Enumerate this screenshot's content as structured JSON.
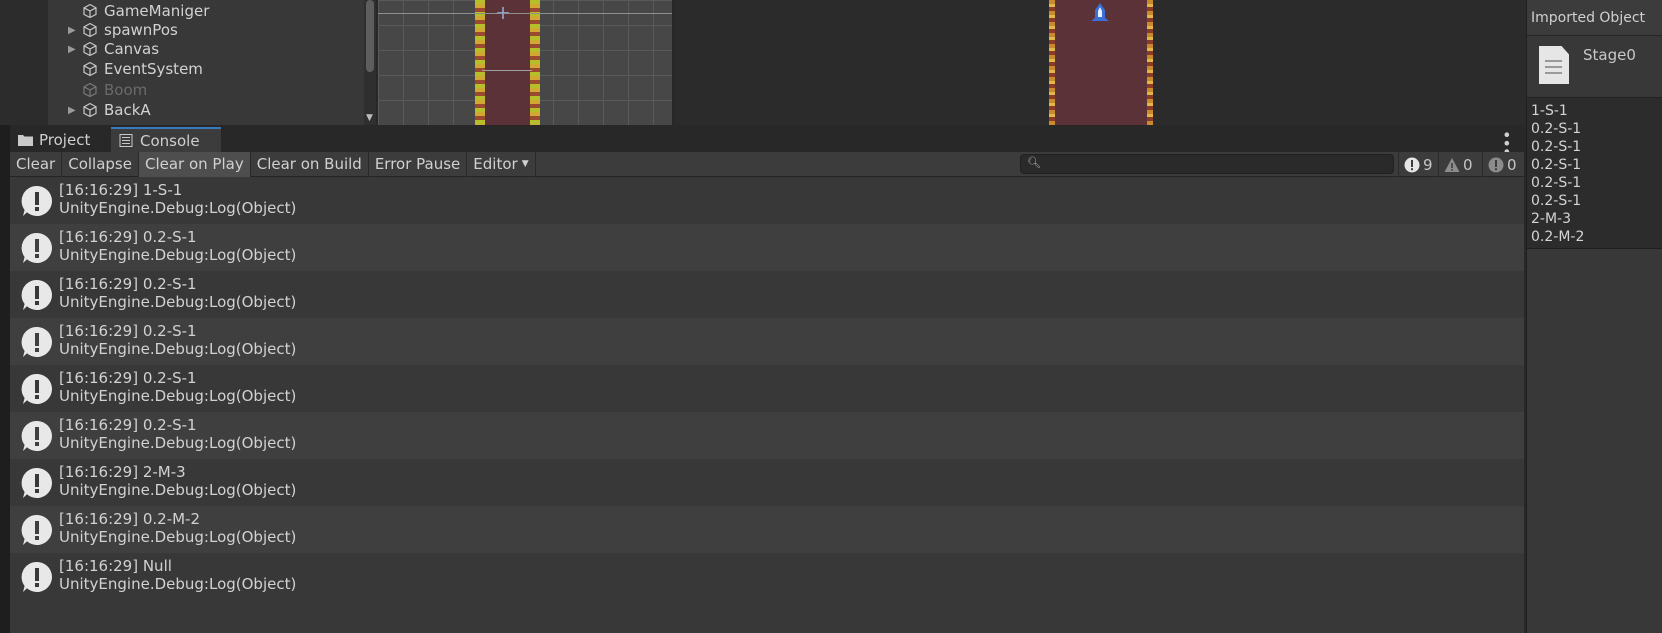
{
  "hierarchy": {
    "items": [
      {
        "label": "GameManiger",
        "arrow": ""
      },
      {
        "label": "spawnPos",
        "arrow": "▶"
      },
      {
        "label": "Canvas",
        "arrow": "▶"
      },
      {
        "label": "EventSystem",
        "arrow": ""
      },
      {
        "label": "Boom",
        "arrow": ""
      },
      {
        "label": "BackA",
        "arrow": "▶"
      }
    ]
  },
  "inspector": {
    "title": "Imported Object",
    "asset_name": "Stage0",
    "text_lines": [
      "1-S-1",
      "0.2-S-1",
      "0.2-S-1",
      "0.2-S-1",
      "0.2-S-1",
      "0.2-S-1",
      "2-M-3",
      "0.2-M-2"
    ]
  },
  "tabs": {
    "project": "Project",
    "console": "Console"
  },
  "toolbar": {
    "clear": "Clear",
    "collapse": "Collapse",
    "clear_on_play": "Clear on Play",
    "clear_on_build": "Clear on Build",
    "error_pause": "Error Pause",
    "editor": "Editor",
    "search_value": "",
    "log_count": "9",
    "warning_count": "0",
    "error_count": "0"
  },
  "logs": [
    {
      "message": "[16:16:29] 1-S-1",
      "stack": "UnityEngine.Debug:Log(Object)"
    },
    {
      "message": "[16:16:29] 0.2-S-1",
      "stack": "UnityEngine.Debug:Log(Object)"
    },
    {
      "message": "[16:16:29] 0.2-S-1",
      "stack": "UnityEngine.Debug:Log(Object)"
    },
    {
      "message": "[16:16:29] 0.2-S-1",
      "stack": "UnityEngine.Debug:Log(Object)"
    },
    {
      "message": "[16:16:29] 0.2-S-1",
      "stack": "UnityEngine.Debug:Log(Object)"
    },
    {
      "message": "[16:16:29] 0.2-S-1",
      "stack": "UnityEngine.Debug:Log(Object)"
    },
    {
      "message": "[16:16:29] 2-M-3",
      "stack": "UnityEngine.Debug:Log(Object)"
    },
    {
      "message": "[16:16:29] 0.2-M-2",
      "stack": "UnityEngine.Debug:Log(Object)"
    },
    {
      "message": "[16:16:29] Null",
      "stack": "UnityEngine.Debug:Log(Object)"
    }
  ],
  "colors": {
    "tab_accent": "#3a79bb",
    "road": "#5a3238"
  }
}
